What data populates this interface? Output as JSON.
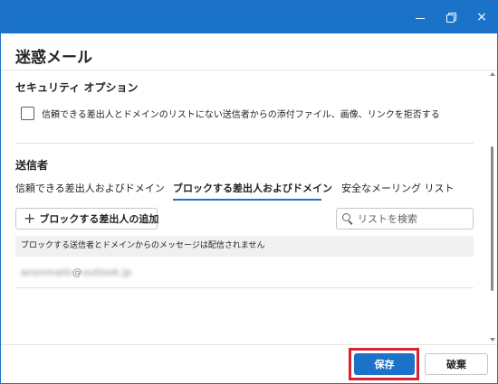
{
  "window": {
    "accent_color": "#1a73c9",
    "controls": {
      "minimize": "minimize-icon",
      "maximize": "restore-icon",
      "close": "×"
    }
  },
  "dialog": {
    "title": "迷惑メール"
  },
  "security": {
    "title": "セキュリティ オプション",
    "checkbox_label": "信頼できる差出人とドメインのリストにない送信者からの添付ファイル、画像、リンクを拒否する",
    "checked": false
  },
  "senders": {
    "title": "送信者",
    "tabs": [
      {
        "label": "信頼できる差出人およびドメイン",
        "selected": false
      },
      {
        "label": "ブロックする差出人およびドメイン",
        "selected": true
      },
      {
        "label": "安全なメーリング リスト",
        "selected": false
      }
    ],
    "add_button": {
      "icon": "+",
      "label": "ブロックする差出人の追加"
    },
    "search": {
      "placeholder": "リストを検索",
      "value": ""
    },
    "list_header": "ブロックする送信者とドメインからのメッセージは配信されません",
    "entries": [
      {
        "local": "anonmails",
        "at": "@",
        "domain": "outlook.jp"
      }
    ]
  },
  "footer": {
    "save_label": "保存",
    "discard_label": "破棄",
    "highlight_color": "#d7232f"
  }
}
